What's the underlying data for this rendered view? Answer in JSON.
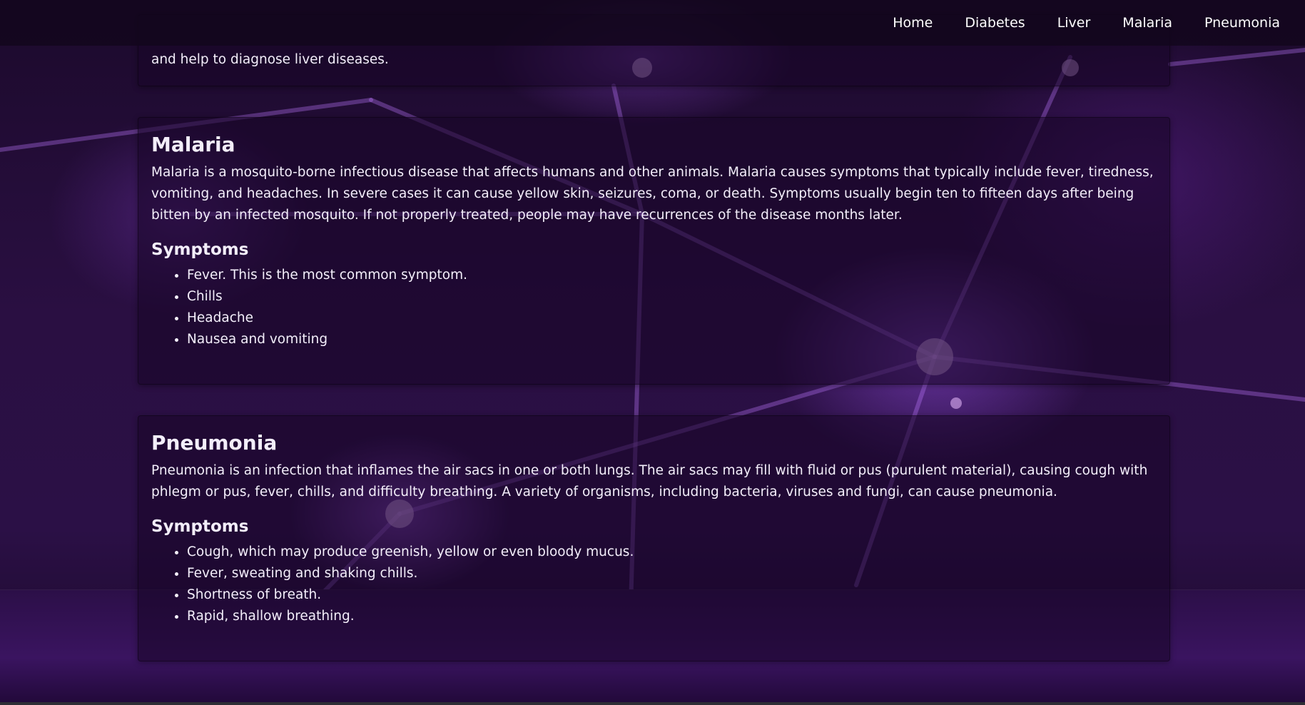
{
  "nav": {
    "items": [
      "Home",
      "Diabetes",
      "Liver",
      "Malaria",
      "Pneumonia"
    ]
  },
  "liver_card": {
    "text_fragment": "and help to diagnose liver diseases."
  },
  "malaria": {
    "title": "Malaria",
    "description": "Malaria is a mosquito-borne infectious disease that affects humans and other animals. Malaria causes symptoms that typically include fever, tiredness, vomiting, and headaches. In severe cases it can cause yellow skin, seizures, coma, or death. Symptoms usually begin ten to fifteen days after being bitten by an infected mosquito. If not properly treated, people may have recurrences of the disease months later.",
    "symptoms_heading": "Symptoms",
    "symptoms": [
      "Fever. This is the most common symptom.",
      "Chills",
      "Headache",
      "Nausea and vomiting"
    ]
  },
  "pneumonia": {
    "title": "Pneumonia",
    "description": "Pneumonia is an infection that inflames the air sacs in one or both lungs. The air sacs may fill with fluid or pus (purulent material), causing cough with phlegm or pus, fever, chills, and difficulty breathing. A variety of organisms, including bacteria, viruses and fungi, can cause pneumonia.",
    "symptoms_heading": "Symptoms",
    "symptoms": [
      "Cough, which may produce greenish, yellow or even bloody mucus.",
      "Fever, sweating and shaking chills.",
      "Shortness of breath.",
      "Rapid, shallow breathing."
    ]
  },
  "colors": {
    "background": "#2a0f42",
    "accent": "#a55ce6",
    "text": "#f3eefa",
    "navbar": "#12061c"
  }
}
